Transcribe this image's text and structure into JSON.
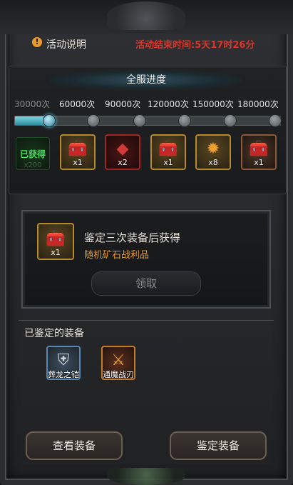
{
  "header": {
    "info_icon": "!",
    "title": "活动说明",
    "countdown": "活动结束时间:5天17时26分"
  },
  "progress": {
    "title": "全服进度",
    "milestones": [
      "30000次",
      "60000次",
      "90000次",
      "120000次",
      "150000次",
      "180000次"
    ],
    "current_stage": 1,
    "claimed_label": "已获得",
    "claimed_qty": "x200",
    "rewards": [
      {
        "icon": "treasure-chest-icon",
        "glyph": "🧰",
        "qty": "x1"
      },
      {
        "icon": "red-crystal-icon",
        "glyph": "◆",
        "qty": "x2"
      },
      {
        "icon": "treasure-chest-icon",
        "glyph": "🧰",
        "qty": "x1"
      },
      {
        "icon": "fire-emblem-icon",
        "glyph": "✹",
        "qty": "x8"
      },
      {
        "icon": "silver-chest-icon",
        "glyph": "🧰",
        "qty": "x1"
      }
    ]
  },
  "reward_card": {
    "icon": "treasure-chest-icon",
    "glyph": "🧰",
    "qty": "x1",
    "title": "鉴定三次装备后获得",
    "subtitle": "随机矿石战利品",
    "claim_label": "领取"
  },
  "identified": {
    "header": "已鉴定的装备",
    "items": [
      {
        "name": "葬龙之铠",
        "icon": "armor-icon",
        "glyph": "⛨",
        "rarity": "blue"
      },
      {
        "name": "通魔战刃",
        "icon": "blade-icon",
        "glyph": "⚔",
        "rarity": "orange"
      }
    ]
  },
  "buttons": {
    "view_equipment": "查看装备",
    "identify_equipment": "鉴定装备"
  },
  "colors": {
    "countdown": "#e23328",
    "subtitle": "#e6962c",
    "progress_fill": "#5fd3ea",
    "claimed": "#3ee05a"
  }
}
